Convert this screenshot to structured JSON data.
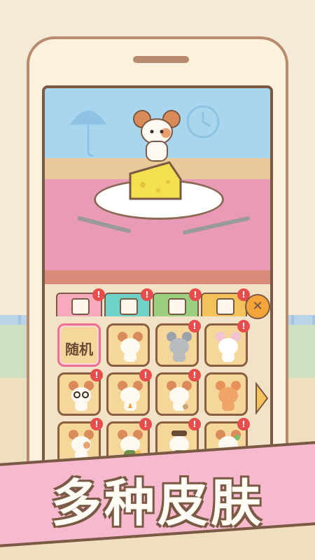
{
  "banner": {
    "title": "多种皮肤"
  },
  "panel": {
    "tabs": [
      {
        "name": "skins",
        "has_alert": true
      },
      {
        "name": "cheese",
        "has_alert": true
      },
      {
        "name": "furniture",
        "has_alert": true
      },
      {
        "name": "plate",
        "has_alert": true
      }
    ],
    "alert_symbol": "!",
    "close_icon": "×",
    "grid": [
      {
        "label": "随机",
        "alert": false
      },
      {
        "label": "",
        "alert": false
      },
      {
        "label": "",
        "alert": true
      },
      {
        "label": "",
        "alert": true
      },
      {
        "label": "",
        "alert": true
      },
      {
        "label": "",
        "alert": true
      },
      {
        "label": "",
        "alert": true
      },
      {
        "label": "",
        "alert": false
      },
      {
        "label": "",
        "alert": true
      },
      {
        "label": "",
        "alert": true
      },
      {
        "label": "",
        "alert": true
      },
      {
        "label": "",
        "alert": true
      }
    ]
  },
  "colors": {
    "accent_pink": "#f6b9cd",
    "cell_bg": "#f6d79b",
    "alert": "#e94c4c"
  }
}
